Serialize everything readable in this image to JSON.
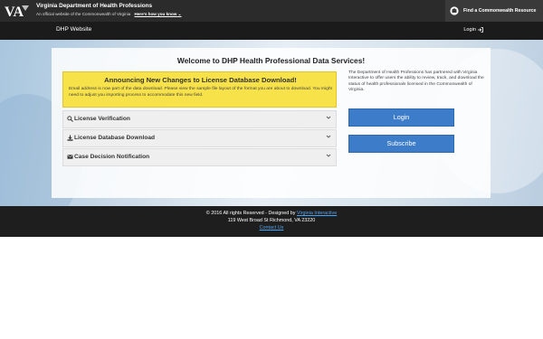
{
  "commonwealth": {
    "title": "Virginia Department of Health Professions",
    "official_text": "An official website of the Commonwealth of Virginia",
    "how_link": "Here's how you know",
    "find_resource": "Find a Commonwealth Resource",
    "logo_text": "VA"
  },
  "nav": {
    "brand": "DHP Website",
    "login": "Login"
  },
  "main": {
    "title": "Welcome to DHP Health Professional Data Services!",
    "notice": {
      "title": "Announcing New Changes to License Database Download!",
      "body": "Email address is now part of the data download. Please view the sample file layout of the format you are about to download. You might need to adjust you importing process to accommodate this new field."
    },
    "accordion": [
      {
        "label": "License Verification",
        "icon": "search-icon"
      },
      {
        "label": "License Database Download",
        "icon": "download-icon"
      },
      {
        "label": "Case Decision Notification",
        "icon": "envelope-icon"
      }
    ],
    "side_text": "The Department of Health Professions has partnered with Virginia Interactive to offer users the ability to review, track, and download the status of health professionals licensed in the Commonwealth of Virginia.",
    "login_button": "Login",
    "subscribe_button": "Subscribe"
  },
  "footer": {
    "copyright": "© 2016 All rights Reserved - Designed by",
    "designer_link": "Virginia Interactive",
    "address": "119 West Broad St Richmond, VA 23220",
    "contact": "Contact Us"
  },
  "colors": {
    "notice_bg": "#f8e24a",
    "button_bg": "#3d7cc9",
    "footer_bg": "#1e1e1e",
    "link": "#4ea3f0"
  }
}
